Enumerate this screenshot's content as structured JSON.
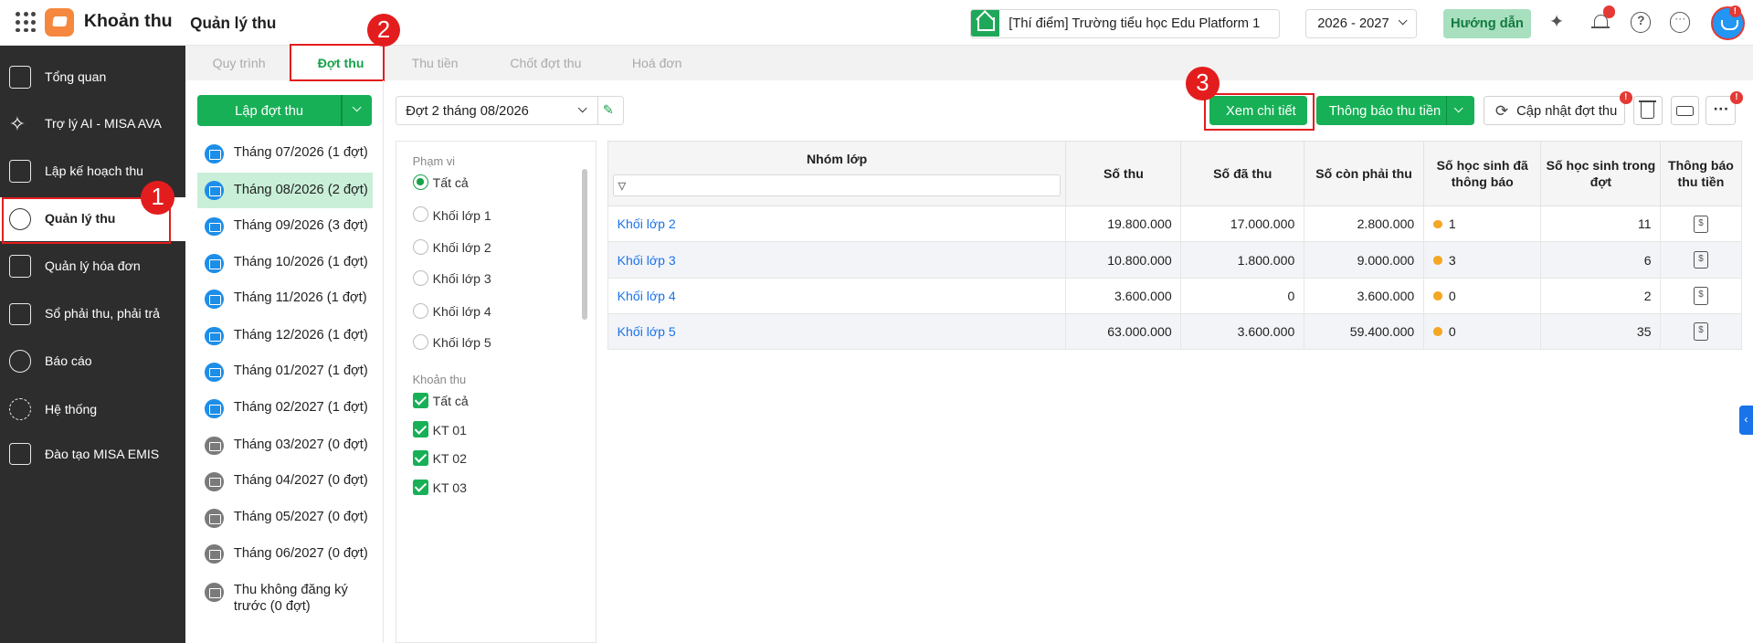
{
  "app": {
    "name": "Khoản thu",
    "page_title": "Quản lý thu"
  },
  "header": {
    "school": "[Thí điểm] Trường tiểu học Edu Platform 1",
    "year": "2026 - 2027",
    "help_label": "Hướng dẫn",
    "badge": "!"
  },
  "sidebar": {
    "items": [
      {
        "label": "Tổng quan",
        "icon": "bar-chart-icon"
      },
      {
        "label": "Trợ lý AI - MISA AVA",
        "icon": "sparkle-icon"
      },
      {
        "label": "Lập kế hoạch thu",
        "icon": "calendar-money-icon"
      },
      {
        "label": "Quản lý thu",
        "icon": "hand-coin-icon"
      },
      {
        "label": "Quản lý hóa đơn",
        "icon": "invoice-icon"
      },
      {
        "label": "Sổ phải thu, phải trả",
        "icon": "ledger-icon"
      },
      {
        "label": "Báo cáo",
        "icon": "pie-chart-icon"
      },
      {
        "label": "Hệ thống",
        "icon": "gear-icon"
      },
      {
        "label": "Đào tạo MISA EMIS",
        "icon": "book-icon"
      }
    ]
  },
  "tabs": [
    "Quy trình",
    "Đợt thu",
    "Thu tiền",
    "Chốt đợt thu",
    "Hoá đơn"
  ],
  "steps": [
    "1",
    "2",
    "3"
  ],
  "list": {
    "create_label": "Lập đợt thu",
    "periods": [
      "Tháng 07/2026 (1 đợt)",
      "Tháng 08/2026 (2 đợt)",
      "Tháng 09/2026 (3 đợt)",
      "Tháng 10/2026 (1 đợt)",
      "Tháng 11/2026 (1 đợt)",
      "Tháng 12/2026 (1 đợt)",
      "Tháng 01/2027 (1 đợt)",
      "Tháng 02/2027 (1 đợt)",
      "Tháng 03/2027 (0 đợt)",
      "Tháng 04/2027 (0 đợt)",
      "Tháng 05/2027 (0 đợt)",
      "Tháng 06/2027 (0 đợt)",
      "Thu không đăng ký trước (0 đợt)"
    ]
  },
  "toolbar": {
    "period_select": "Đợt 2 tháng 08/2026",
    "view_detail": "Xem chi tiết",
    "notify": "Thông báo thu tiền",
    "update": "Cập nhật đợt thu"
  },
  "filter": {
    "scope_title": "Phạm vi",
    "scope_options": [
      "Tất cả",
      "Khối lớp 1",
      "Khối lớp 2",
      "Khối lớp 3",
      "Khối lớp 4",
      "Khối lớp 5"
    ],
    "fee_title": "Khoản thu",
    "fee_options": [
      "Tất cả",
      "KT 01",
      "KT 02",
      "KT 03"
    ]
  },
  "table": {
    "headers": [
      "Nhóm lớp",
      "Số thu",
      "Số đã thu",
      "Số còn phải thu",
      "Số học sinh đã thông báo",
      "Số học sinh trong đợt",
      "Thông báo thu tiền"
    ],
    "rows": [
      [
        "Khối lớp 2",
        "19.800.000",
        "17.000.000",
        "2.800.000",
        "1",
        "11"
      ],
      [
        "Khối lớp 3",
        "10.800.000",
        "1.800.000",
        "9.000.000",
        "3",
        "6"
      ],
      [
        "Khối lớp 4",
        "3.600.000",
        "0",
        "3.600.000",
        "0",
        "2"
      ],
      [
        "Khối lớp 5",
        "63.000.000",
        "3.600.000",
        "59.400.000",
        "0",
        "35"
      ]
    ]
  }
}
